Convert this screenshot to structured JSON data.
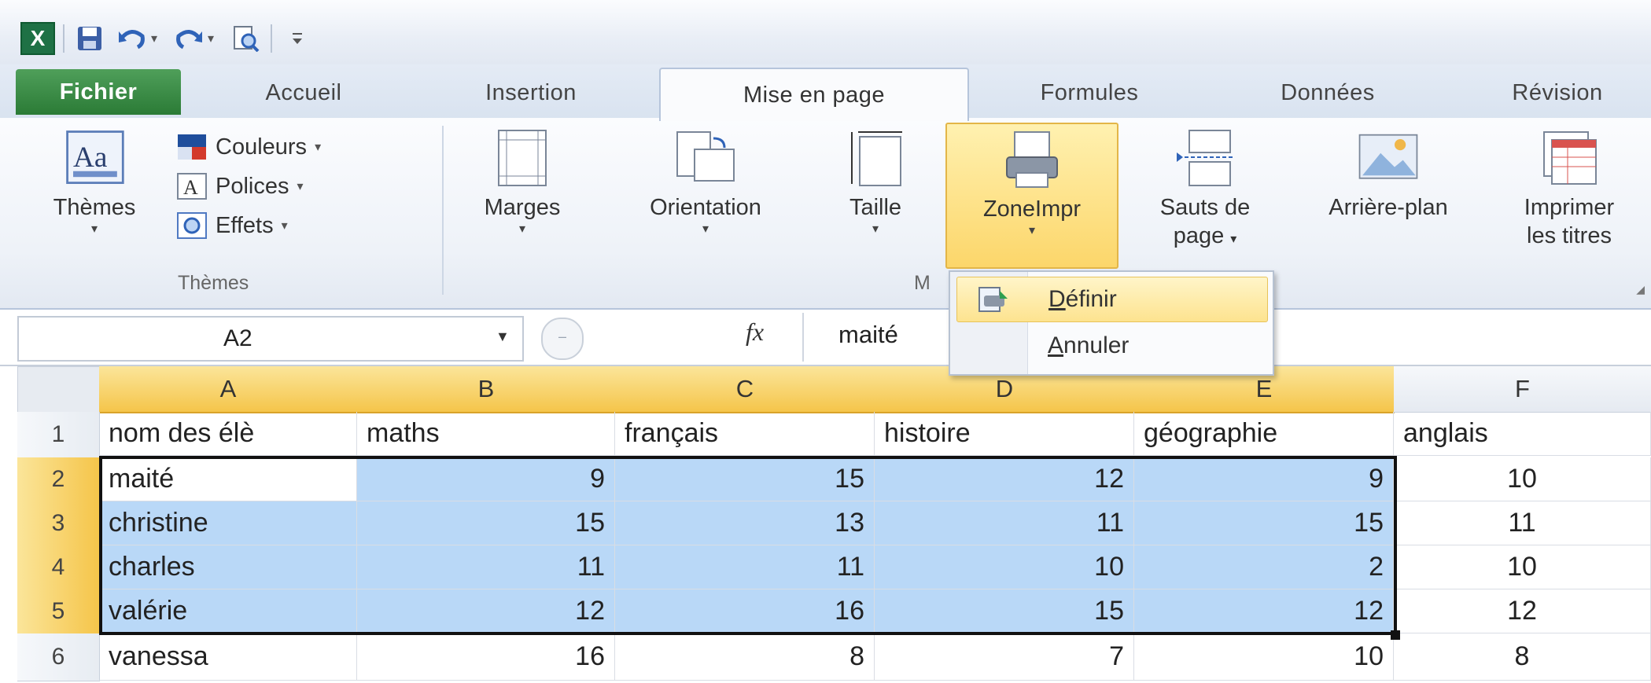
{
  "title_bar": {
    "app_icon": "excel-icon",
    "quick_access": [
      "save-icon",
      "undo-icon",
      "redo-icon",
      "print-preview-icon",
      "customize-qat-icon"
    ]
  },
  "tabs": [
    {
      "label": "Fichier"
    },
    {
      "label": "Accueil"
    },
    {
      "label": "Insertion"
    },
    {
      "label": "Mise en page"
    },
    {
      "label": "Formules"
    },
    {
      "label": "Données"
    },
    {
      "label": "Révision"
    }
  ],
  "ribbon": {
    "themes": {
      "label": "Thèmes",
      "group_label": "Thèmes",
      "colors": "Couleurs",
      "fonts": "Polices",
      "effects": "Effets"
    },
    "margins": "Marges",
    "orientation": "Orientation",
    "size": "Taille",
    "print_area": "ZoneImpr",
    "breaks_line1": "Sauts de",
    "breaks_line2": "page",
    "background": "Arrière-plan",
    "print_titles_line1": "Imprimer",
    "print_titles_line2": "les titres",
    "page_setup_group_fragment": "M"
  },
  "dropdown": {
    "define_first": "D",
    "define_rest": "éfinir",
    "cancel_first": "A",
    "cancel_rest": "nnuler"
  },
  "formula_bar": {
    "name_box": "A2",
    "fx_label": "fx",
    "value": "maité"
  },
  "sheet": {
    "columns": [
      "A",
      "B",
      "C",
      "D",
      "E",
      "F"
    ],
    "rows": [
      {
        "num": "1",
        "cells": [
          "nom des élè",
          "maths",
          "français",
          "histoire",
          "géographie",
          "anglais"
        ]
      },
      {
        "num": "2",
        "cells": [
          "maité",
          "9",
          "15",
          "12",
          "9",
          "10"
        ]
      },
      {
        "num": "3",
        "cells": [
          "christine",
          "15",
          "13",
          "11",
          "15",
          "11"
        ]
      },
      {
        "num": "4",
        "cells": [
          "charles",
          "11",
          "11",
          "10",
          "2",
          "10"
        ]
      },
      {
        "num": "5",
        "cells": [
          "valérie",
          "12",
          "16",
          "15",
          "12",
          "12"
        ]
      },
      {
        "num": "6",
        "cells": [
          "vanessa",
          "16",
          "8",
          "7",
          "10",
          "8"
        ]
      }
    ]
  },
  "colors": {
    "selection_fill": "#b9d8f7",
    "header_highlight": "#f5c54a",
    "file_tab": "#2b7b36"
  }
}
